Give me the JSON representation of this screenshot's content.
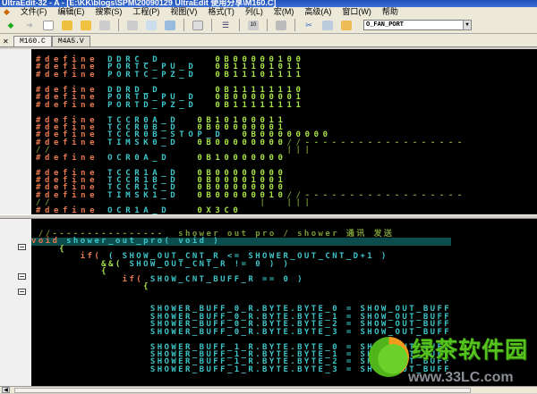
{
  "window": {
    "title": "UltraEdit-32 - A - [E:\\KK\\blogs\\SPM\\20090129 UltraEdit 使用分享\\M160.C]"
  },
  "menu": [
    "文件(F)",
    "编辑(E)",
    "搜索(S)",
    "工程(P)",
    "视图(V)",
    "格式(T)",
    "列(L)",
    "宏(M)",
    "高级(A)",
    "窗口(W)",
    "帮助"
  ],
  "toolbar": {
    "function_list_value": "O_FAN_PORT"
  },
  "tabs": [
    {
      "label": "M160.C",
      "active": true
    },
    {
      "label": "M4A5.V",
      "active": false
    }
  ],
  "pane1_lines": [
    [
      [
        "#define ",
        "def"
      ],
      [
        "DDRC_D      ",
        "id"
      ],
      [
        "0B00000100",
        "val"
      ]
    ],
    [
      [
        "#define ",
        "def"
      ],
      [
        "PORTC_PU_D  ",
        "id"
      ],
      [
        "0B11101011",
        "val"
      ]
    ],
    [
      [
        "#define ",
        "def"
      ],
      [
        "PORTC_PZ_D  ",
        "id"
      ],
      [
        "0B11101111",
        "val"
      ]
    ],
    [],
    [
      [
        "#define ",
        "def"
      ],
      [
        "DDRD_D      ",
        "id"
      ],
      [
        "0B11111110",
        "val"
      ]
    ],
    [
      [
        "#define ",
        "def"
      ],
      [
        "PORTD_PU_D  ",
        "id"
      ],
      [
        "0B00000001",
        "val"
      ]
    ],
    [
      [
        "#define ",
        "def"
      ],
      [
        "PORTD_PZ_D  ",
        "id"
      ],
      [
        "0B11111111",
        "val"
      ]
    ],
    [],
    [
      [
        "#define ",
        "def"
      ],
      [
        "TCCR0A_D  ",
        "id"
      ],
      [
        "0B10100011",
        "val"
      ]
    ],
    [
      [
        "#define ",
        "def"
      ],
      [
        "TCCR0B_D  ",
        "id"
      ],
      [
        "0B00000001",
        "val"
      ]
    ],
    [
      [
        "#define ",
        "def"
      ],
      [
        "TCCR0B_STOP_D  ",
        "id"
      ],
      [
        "0B00000000",
        "val"
      ]
    ],
    [
      [
        "#define ",
        "def"
      ],
      [
        "TIMSK0_D  ",
        "id"
      ],
      [
        "0B00000000",
        "val"
      ],
      [
        "//------------------",
        "cmt"
      ]
    ],
    [
      [
        "//                          |||",
        "cmt"
      ]
    ],
    [
      [
        "#define ",
        "def"
      ],
      [
        "OCR0A_D   ",
        "id"
      ],
      [
        "0B10000000",
        "val"
      ]
    ],
    [],
    [
      [
        "#define ",
        "def"
      ],
      [
        "TCCR1A_D  ",
        "id"
      ],
      [
        "0B00000000",
        "val"
      ]
    ],
    [
      [
        "#define ",
        "def"
      ],
      [
        "TCCR1B_D  ",
        "id"
      ],
      [
        "0B00001001",
        "val"
      ]
    ],
    [
      [
        "#define ",
        "def"
      ],
      [
        "TCCR1C_D  ",
        "id"
      ],
      [
        "0B00000000",
        "val"
      ]
    ],
    [
      [
        "#define ",
        "def"
      ],
      [
        "TIMSK1_D  ",
        "id"
      ],
      [
        "0B00000010",
        "val"
      ],
      [
        "//------------------",
        "cmt"
      ]
    ],
    [
      [
        "//                       |  |||",
        "cmt"
      ]
    ],
    [
      [
        "#define ",
        "def"
      ],
      [
        "OCR1A_D   ",
        "id"
      ],
      [
        "0X3C0",
        "val"
      ]
    ]
  ],
  "pane2_lines": [
    [
      [
        " //----------------  shower out pro / shower 通讯 发送",
        "cmt"
      ]
    ],
    [
      [
        "void ",
        "kw"
      ],
      [
        "shower_out_pro( void )",
        "txt"
      ]
    ],
    [
      [
        "    {",
        "op"
      ]
    ],
    [
      [
        "       if( ",
        "kw"
      ],
      [
        "( SHOW_OUT_CNT_R <= SHOWER_OUT_CNT_D+1 )",
        "txt"
      ]
    ],
    [
      [
        "          &&( ",
        "op"
      ],
      [
        "SHOW_OUT_CNT_R != 0 ) )",
        "txt"
      ]
    ],
    [
      [
        "          {",
        "op"
      ]
    ],
    [
      [
        "             if( ",
        "kw"
      ],
      [
        "SHOW_CNT_BUFF_R == 0 )",
        "txt"
      ]
    ],
    [
      [
        "                {",
        "op"
      ]
    ],
    [],
    [],
    [
      [
        "                 SHOWER_BUFF_0_R.BYTE.BYTE_0 = SHOW_OUT_BUFF",
        "txt"
      ]
    ],
    [
      [
        "                 SHOWER_BUFF_0_R.BYTE.BYTE_1 = SHOW_OUT_BUFF",
        "txt"
      ]
    ],
    [
      [
        "                 SHOWER_BUFF_0_R.BYTE.BYTE_2 = SHOW_OUT_BUFF",
        "txt"
      ]
    ],
    [
      [
        "                 SHOWER_BUFF_0_R.BYTE.BYTE_3 = SHOW_OUT_BUFF",
        "txt"
      ]
    ],
    [],
    [
      [
        "                 SHOWER_BUFF_1_R.BYTE.BYTE_0 = SHOW_OUT_BUFF",
        "txt"
      ]
    ],
    [
      [
        "                 SHOWER_BUFF_1_R.BYTE.BYTE_1 = SHOW_OUT_BUFF",
        "txt"
      ]
    ],
    [
      [
        "                 SHOWER_BUFF_1_R.BYTE.BYTE_2 = SHOW_OUT_BUFF",
        "txt"
      ]
    ],
    [
      [
        "                 SHOWER_BUFF_1_R.BYTE.BYTE_3 = SHOW_OUT_BUFF",
        "txt"
      ]
    ]
  ],
  "watermark": {
    "name": "绿茶软件园",
    "url": "www.33LC.com"
  },
  "colors": {
    "define": "#e8784e",
    "identifier": "#3ec4c8",
    "value": "#a8e048",
    "comment": "#7a9a38",
    "current_line": "#0b4c4c"
  }
}
